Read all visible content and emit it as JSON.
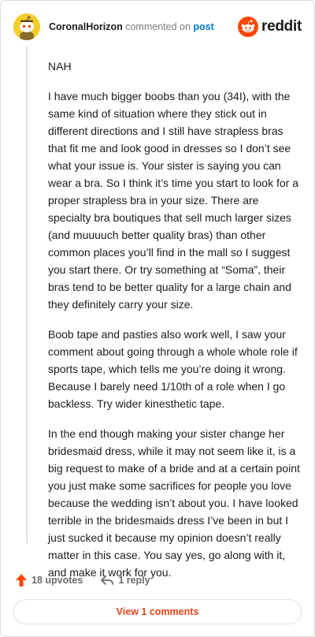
{
  "header": {
    "username": "CoronalHorizon",
    "action": "commented on",
    "post_link": "post",
    "brand": "reddit",
    "avatar_icon": "snoo-avatar-icon",
    "brand_icon": "reddit-logo-icon"
  },
  "comment": {
    "paragraphs": [
      "NAH",
      "I have much bigger boobs than you (34I), with the same kind of situation where they stick out in different directions and I still have strapless bras that fit me and look good in dresses so I don’t see what your issue is. Your sister is saying you can wear a bra. So I think it’s time you start to look for a proper strapless bra in your size. There are specialty bra boutiques that sell much larger sizes (and muuuuch better quality bras) than other common places you’ll find in the mall so I suggest you start there. Or try something at “Soma”, their bras tend to be better quality for a large chain and they definitely carry your size.",
      "Boob tape and pasties also work well, I saw your comment about going through a whole whole role if sports tape, which tells me you’re doing it wrong. Because I barely need 1/10th of a role when I go backless. Try wider kinesthetic tape.",
      "In the end though making your sister change her bridesmaid dress, while it may not seem like it, is a big request to make of a bride and at a certain point you just make some sacrifices for people you love because the wedding isn’t about you. I have looked terrible in the bridesmaids dress I’ve been in but I just sucked it because my opinion doesn’t really matter in this case. You say yes, go along with it, and make it work for you."
    ]
  },
  "actions": {
    "upvotes_label": "18 upvotes",
    "reply_label": "1 reply",
    "upvote_icon": "upvote-arrow-icon",
    "reply_icon": "reply-arrow-icon"
  },
  "footer": {
    "view_comments_label": "View 1 comments"
  },
  "colors": {
    "brand_orange": "#ff4500",
    "upvote": "#ff4500",
    "link_blue": "#0079d3",
    "view_button_text": "#e5451a",
    "avatar_bg": "#f5cd2b"
  }
}
